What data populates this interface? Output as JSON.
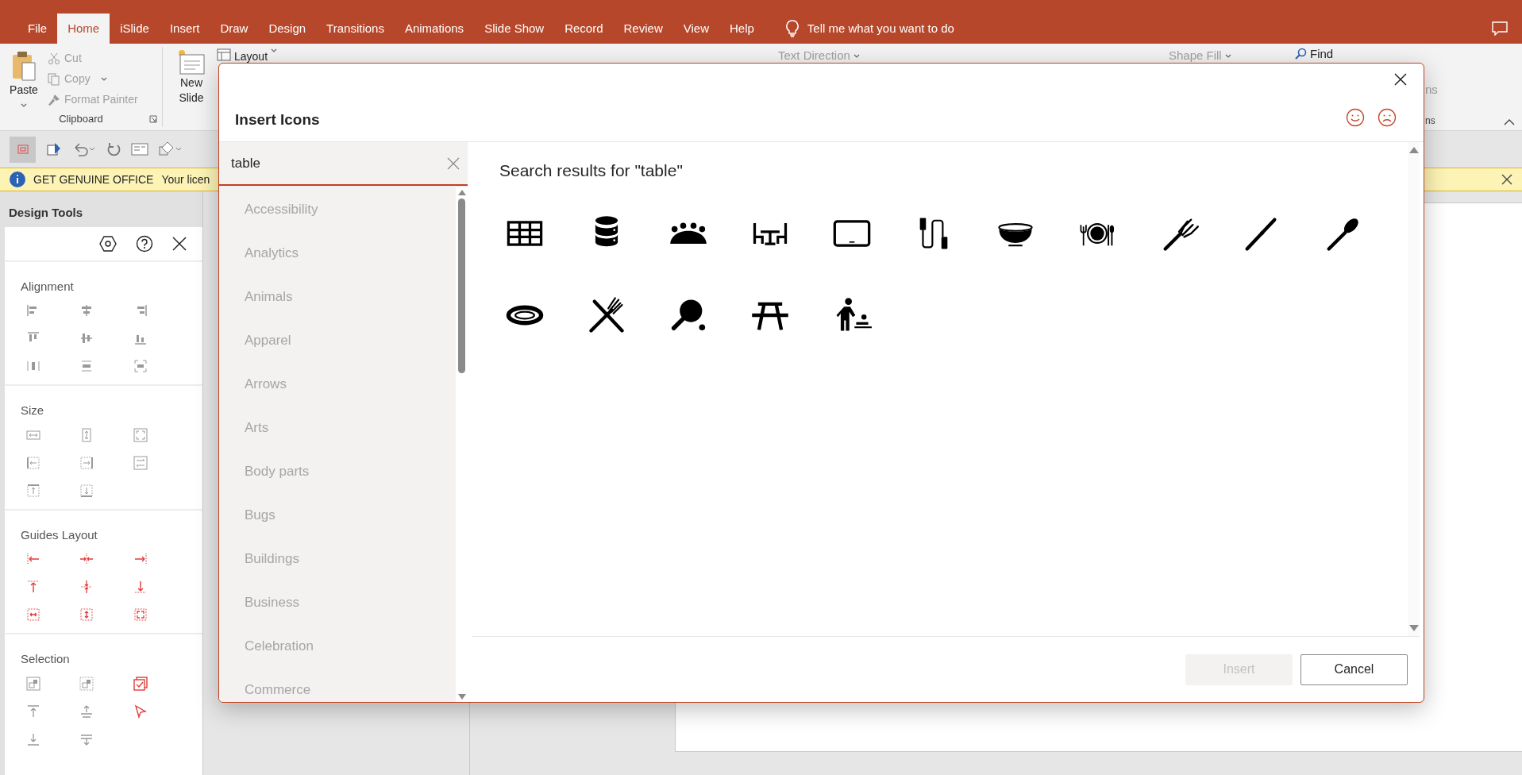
{
  "tabs": [
    {
      "label": "File",
      "selected": false
    },
    {
      "label": "Home",
      "selected": true
    },
    {
      "label": "iSlide",
      "selected": false
    },
    {
      "label": "Insert",
      "selected": false
    },
    {
      "label": "Draw",
      "selected": false
    },
    {
      "label": "Design",
      "selected": false
    },
    {
      "label": "Transitions",
      "selected": false
    },
    {
      "label": "Animations",
      "selected": false
    },
    {
      "label": "Slide Show",
      "selected": false
    },
    {
      "label": "Record",
      "selected": false
    },
    {
      "label": "Review",
      "selected": false
    },
    {
      "label": "View",
      "selected": false
    },
    {
      "label": "Help",
      "selected": false
    }
  ],
  "tell_me": {
    "placeholder": "Tell me what you want to do"
  },
  "ribbon": {
    "paste": "Paste",
    "cut": "Cut",
    "copy": "Copy",
    "format_painter": "Format Painter",
    "clipboard_label": "Clipboard",
    "new_slide": "New Slide",
    "layout": "Layout",
    "text_direction": "Text Direction",
    "shape_fill": "Shape Fill",
    "find": "Find",
    "cut_group_label": "ns",
    "cut_group_label_upper": "ns"
  },
  "notice": {
    "title": "GET GENUINE OFFICE",
    "text": "Your licen"
  },
  "design_tools": {
    "title": "Design Tools",
    "sections": [
      {
        "heading": "Alignment",
        "kind": "align"
      },
      {
        "heading": "Size",
        "kind": "size"
      },
      {
        "heading": "Guides Layout",
        "kind": "guides"
      },
      {
        "heading": "Selection",
        "kind": "selection"
      }
    ]
  },
  "dialog": {
    "title": "Insert Icons",
    "search": {
      "value": "table"
    },
    "categories": [
      "Accessibility",
      "Analytics",
      "Animals",
      "Apparel",
      "Arrows",
      "Arts",
      "Body parts",
      "Bugs",
      "Buildings",
      "Business",
      "Celebration",
      "Commerce"
    ],
    "results_heading": "Search results for \"table\"",
    "buttons": [
      {
        "label": "Insert",
        "disabled": true
      },
      {
        "label": "Cancel",
        "disabled": false
      }
    ]
  }
}
